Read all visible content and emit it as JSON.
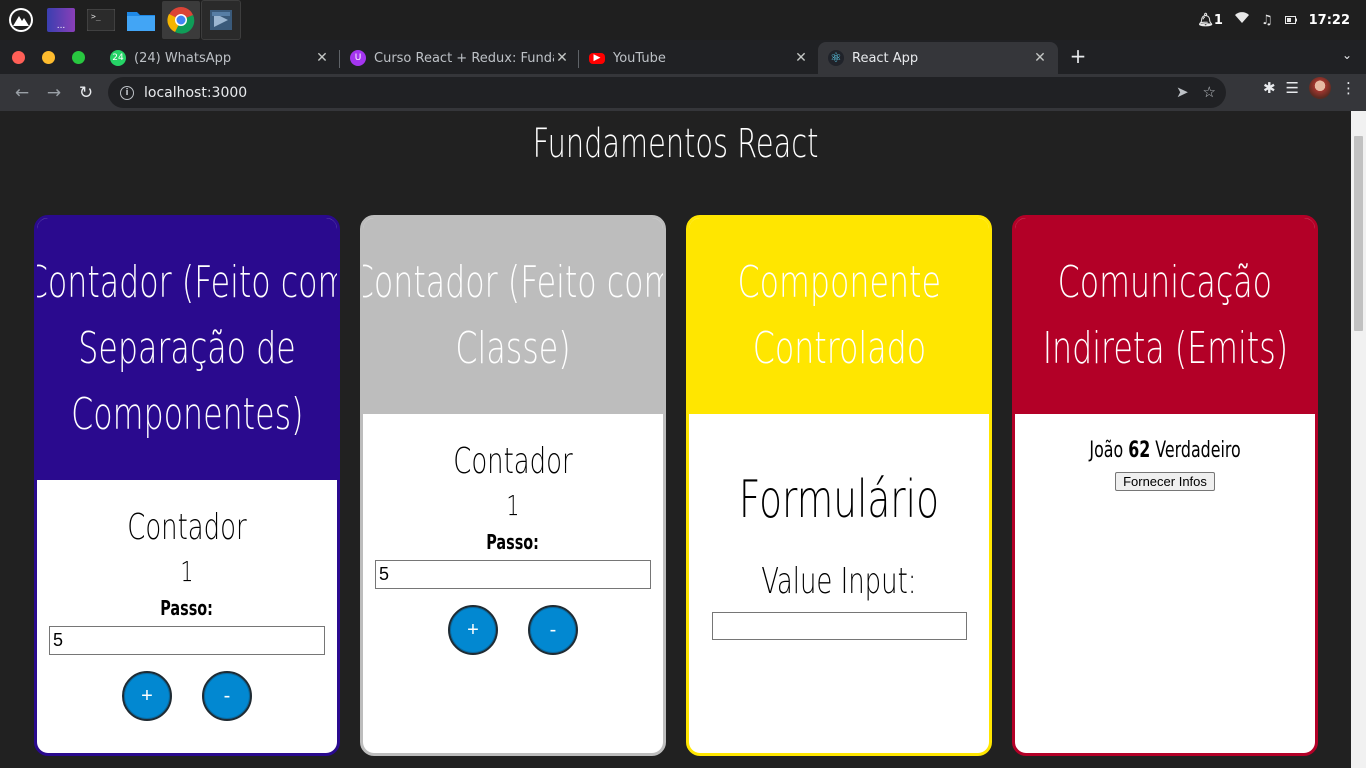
{
  "os": {
    "clock": "17:22",
    "notification_count": "1",
    "apps": [
      "launcher-icon",
      "workspaces-icon",
      "terminal-icon",
      "files-icon",
      "chrome-icon",
      "vscode-icon"
    ]
  },
  "browser": {
    "tabs": [
      {
        "title": "(24) WhatsApp",
        "badge": "24",
        "icon": "whatsapp-icon",
        "color": "#25d366"
      },
      {
        "title": "Curso React + Redux: Fundame",
        "icon": "udemy-icon",
        "color": "#a435f0"
      },
      {
        "title": "YouTube",
        "icon": "youtube-icon",
        "color": "#ff0000"
      },
      {
        "title": "React App",
        "icon": "react-icon",
        "color": "#61dafb"
      }
    ],
    "url": "localhost:3000"
  },
  "page": {
    "title": "Fundamentos React",
    "cards": {
      "separated": {
        "title_line1": "Contador (Feito com",
        "title_line2": "Separação de",
        "title_line3": "Componentes)",
        "counter_label": "Contador",
        "counter_value": "1",
        "step_label": "Passo:",
        "step_value": "5",
        "plus": "+",
        "minus": "-",
        "color": "#2a0a8e"
      },
      "class": {
        "title_line1": "Contador (Feito com",
        "title_line2": "Classe)",
        "counter_label": "Contador",
        "counter_value": "1",
        "step_label": "Passo:",
        "step_value": "5",
        "plus": "+",
        "minus": "-",
        "color": "#bdbdbd"
      },
      "controlled": {
        "title_line1": "Componente",
        "title_line2": "Controlado",
        "form_title": "Formulário",
        "input_label": "Value Input:",
        "input_value": "",
        "color": "#ffe600"
      },
      "emits": {
        "title_line1": "Comunicação",
        "title_line2": "Indireta (Emits)",
        "name": "João",
        "age": "62",
        "flag": "Verdadeiro",
        "button": "Fornecer Infos",
        "color": "#b30027"
      }
    }
  }
}
